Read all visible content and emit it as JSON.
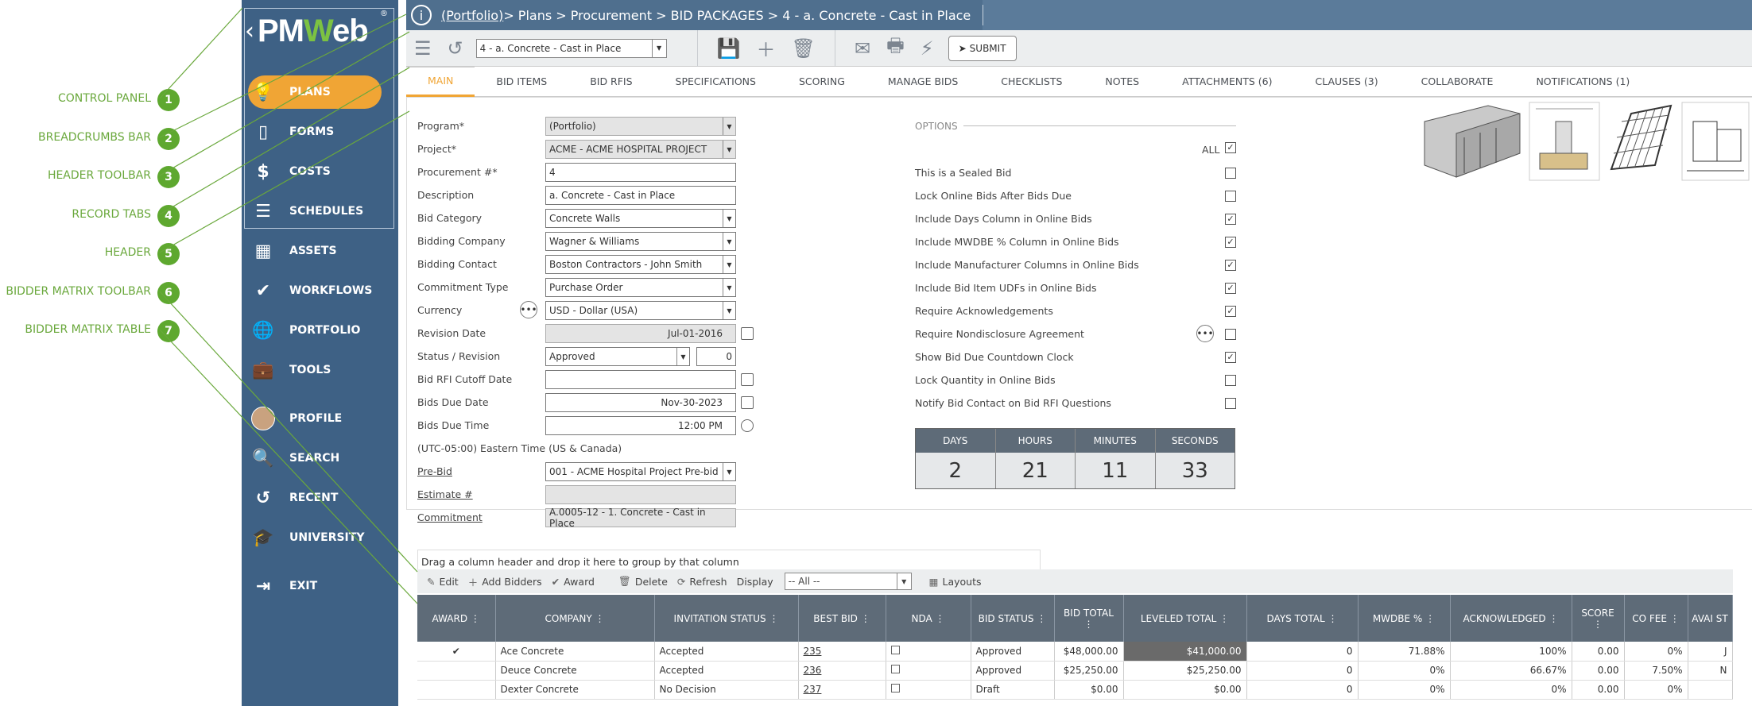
{
  "callouts": [
    {
      "n": "1",
      "label": "CONTROL PANEL"
    },
    {
      "n": "2",
      "label": "BREADCRUMBS BAR"
    },
    {
      "n": "3",
      "label": "HEADER TOOLBAR"
    },
    {
      "n": "4",
      "label": "RECORD TABS"
    },
    {
      "n": "5",
      "label": "HEADER"
    },
    {
      "n": "6",
      "label": "BIDDER MATRIX TOOLBAR"
    },
    {
      "n": "7",
      "label": "BIDDER MATRIX TABLE"
    }
  ],
  "logo": {
    "back": "‹",
    "brand_a": "PM",
    "brand_w": "W",
    "brand_b": "eb",
    "reg": "®"
  },
  "nav": [
    {
      "label": "PLANS",
      "icon": "lightbulb-icon",
      "glyph": "💡"
    },
    {
      "label": "FORMS",
      "icon": "document-icon",
      "glyph": "▯"
    },
    {
      "label": "COSTS",
      "icon": "dollar-icon",
      "glyph": "$"
    },
    {
      "label": "SCHEDULES",
      "icon": "gantt-icon",
      "glyph": "☰"
    },
    {
      "label": "ASSETS",
      "icon": "building-icon",
      "glyph": "▦"
    },
    {
      "label": "WORKFLOWS",
      "icon": "check-icon",
      "glyph": "✔"
    },
    {
      "label": "PORTFOLIO",
      "icon": "globe-icon",
      "glyph": "🌐"
    },
    {
      "label": "TOOLS",
      "icon": "briefcase-icon",
      "glyph": "💼"
    },
    {
      "label": "PROFILE",
      "icon": "avatar-icon",
      "glyph": ""
    },
    {
      "label": "SEARCH",
      "icon": "search-icon",
      "glyph": "🔍"
    },
    {
      "label": "RECENT",
      "icon": "history-icon",
      "glyph": "↺"
    },
    {
      "label": "UNIVERSITY",
      "icon": "graduation-cap-icon",
      "glyph": "🎓"
    },
    {
      "label": "EXIT",
      "icon": "exit-icon",
      "glyph": "⇥"
    }
  ],
  "breadcrumb": {
    "portfolio": "(Portfolio)",
    "rest": " > Plans > Procurement > BID PACKAGES > 4 - a. Concrete - Cast in Place"
  },
  "toolbar": {
    "record_select": "4 -  a. Concrete - Cast in Place",
    "submit": "SUBMIT"
  },
  "tabs": [
    "MAIN",
    "BID ITEMS",
    "BID RFIS",
    "SPECIFICATIONS",
    "SCORING",
    "MANAGE BIDS",
    "CHECKLISTS",
    "NOTES",
    "ATTACHMENTS (6)",
    "CLAUSES (3)",
    "COLLABORATE",
    "NOTIFICATIONS (1)"
  ],
  "form": {
    "program_label": "Program*",
    "program": "(Portfolio)",
    "project_label": "Project*",
    "project": "ACME - ACME HOSPITAL PROJECT",
    "proc_label": "Procurement #*",
    "proc": "4",
    "desc_label": "Description",
    "desc": "a. Concrete - Cast in Place",
    "bidcat_label": "Bid Category",
    "bidcat": "Concrete Walls",
    "bidco_label": "Bidding Company",
    "bidco": "Wagner & Williams",
    "bidcontact_label": "Bidding Contact",
    "bidcontact": "Boston Contractors - John Smith",
    "commit_type_label": "Commitment Type",
    "commit_type": "Purchase Order",
    "currency_label": "Currency",
    "currency": "USD - Dollar (USA)",
    "rev_date_label": "Revision Date",
    "rev_date": "Jul-01-2016",
    "status_label": "Status / Revision",
    "status": "Approved",
    "revision": "0",
    "rfi_cutoff_label": "Bid RFI Cutoff Date",
    "rfi_cutoff": "",
    "due_date_label": "Bids Due Date",
    "due_date": "Nov-30-2023",
    "due_time_label": "Bids Due Time",
    "due_time": "12:00 PM",
    "timezone": "(UTC-05:00) Eastern Time (US & Canada)",
    "prebid_label": "Pre-Bid",
    "prebid": "001 - ACME Hospital Project Pre-bid",
    "estimate_label": "Estimate #",
    "estimate": "",
    "commitment_label": "Commitment",
    "commitment": "A.0005-12 - 1. Concrete - Cast in Place"
  },
  "options": {
    "title": "OPTIONS",
    "all": "ALL",
    "items": [
      {
        "label": "This is a Sealed Bid",
        "checked": false
      },
      {
        "label": "Lock Online Bids After Bids Due",
        "checked": false
      },
      {
        "label": "Include Days Column in Online Bids",
        "checked": true
      },
      {
        "label": "Include MWDBE % Column in Online Bids",
        "checked": true
      },
      {
        "label": "Include Manufacturer Columns in Online Bids",
        "checked": true
      },
      {
        "label": "Include Bid Item UDFs in Online Bids",
        "checked": true
      },
      {
        "label": "Require Acknowledgements",
        "checked": true
      },
      {
        "label": "Require Nondisclosure Agreement",
        "checked": false
      },
      {
        "label": "Show Bid Due Countdown Clock",
        "checked": true
      },
      {
        "label": "Lock Quantity in Online Bids",
        "checked": false
      },
      {
        "label": "Notify Bid Contact on Bid RFI Questions",
        "checked": false
      }
    ]
  },
  "countdown": [
    {
      "label": "DAYS",
      "value": "2"
    },
    {
      "label": "HOURS",
      "value": "21"
    },
    {
      "label": "MINUTES",
      "value": "11"
    },
    {
      "label": "SECONDS",
      "value": "33"
    }
  ],
  "grid": {
    "group_hint": "Drag a column header and drop it here to group by that column",
    "toolbar": {
      "edit": "Edit",
      "add": "Add Bidders",
      "award": "Award",
      "delete": "Delete",
      "refresh": "Refresh",
      "display": "Display",
      "display_value": "-- All --",
      "layouts": "Layouts"
    },
    "columns": [
      "AWARD",
      "COMPANY",
      "INVITATION STATUS",
      "BEST BID",
      "NDA",
      "BID STATUS",
      "BID TOTAL",
      "LEVELED TOTAL",
      "DAYS TOTAL",
      "MWDBE %",
      "ACKNOWLEDGED",
      "SCORE",
      "CO FEE",
      "AVAI ST"
    ],
    "rows": [
      {
        "award": "✔",
        "company": "Ace Concrete",
        "inv": "Accepted",
        "best": "235",
        "status": "Approved",
        "total": "$48,000.00",
        "leveled": "$41,000.00",
        "days": "0",
        "mwdbe": "71.88%",
        "ack": "100%",
        "score": "0.00",
        "fee": "0%",
        "avail": "J"
      },
      {
        "award": "",
        "company": "Deuce Concrete",
        "inv": "Accepted",
        "best": "236",
        "status": "Approved",
        "total": "$25,250.00",
        "leveled": "$25,250.00",
        "days": "0",
        "mwdbe": "0%",
        "ack": "66.67%",
        "score": "0.00",
        "fee": "7.50%",
        "avail": "N"
      },
      {
        "award": "",
        "company": "Dexter Concrete",
        "inv": "No Decision",
        "best": "237",
        "status": "Draft",
        "total": "$0.00",
        "leveled": "$0.00",
        "days": "0",
        "mwdbe": "0%",
        "ack": "0%",
        "score": "0.00",
        "fee": "0%",
        "avail": ""
      }
    ]
  },
  "colors": {
    "sidebar": "#3e6185",
    "accent": "#f0a535",
    "callout": "#5ea82f"
  }
}
